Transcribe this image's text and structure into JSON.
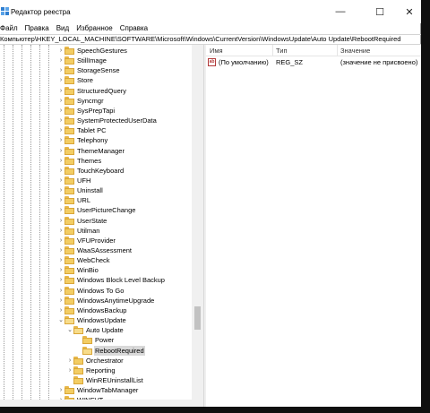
{
  "window": {
    "title": "Редактор реестра",
    "controls": {
      "minimize": "—",
      "maximize": "☐",
      "close": "✕"
    }
  },
  "menu": [
    "Файл",
    "Правка",
    "Вид",
    "Избранное",
    "Справка"
  ],
  "address": "Компьютер\\HKEY_LOCAL_MACHINE\\SOFTWARE\\Microsoft\\Windows\\CurrentVersion\\WindowsUpdate\\Auto Update\\RebootRequired",
  "tree": {
    "items": [
      {
        "label": "SpeechGestures",
        "level": 0,
        "expander": "›",
        "open": false,
        "selected": false
      },
      {
        "label": "StillImage",
        "level": 0,
        "expander": "›",
        "open": false,
        "selected": false
      },
      {
        "label": "StorageSense",
        "level": 0,
        "expander": "›",
        "open": false,
        "selected": false
      },
      {
        "label": "Store",
        "level": 0,
        "expander": "›",
        "open": false,
        "selected": false
      },
      {
        "label": "StructuredQuery",
        "level": 0,
        "expander": "›",
        "open": false,
        "selected": false
      },
      {
        "label": "Syncmgr",
        "level": 0,
        "expander": "›",
        "open": false,
        "selected": false
      },
      {
        "label": "SysPrepTapi",
        "level": 0,
        "expander": "›",
        "open": false,
        "selected": false
      },
      {
        "label": "SystemProtectedUserData",
        "level": 0,
        "expander": "›",
        "open": false,
        "selected": false
      },
      {
        "label": "Tablet PC",
        "level": 0,
        "expander": "›",
        "open": false,
        "selected": false
      },
      {
        "label": "Telephony",
        "level": 0,
        "expander": "›",
        "open": false,
        "selected": false
      },
      {
        "label": "ThemeManager",
        "level": 0,
        "expander": "›",
        "open": false,
        "selected": false
      },
      {
        "label": "Themes",
        "level": 0,
        "expander": "›",
        "open": false,
        "selected": false
      },
      {
        "label": "TouchKeyboard",
        "level": 0,
        "expander": "›",
        "open": false,
        "selected": false
      },
      {
        "label": "UFH",
        "level": 0,
        "expander": "›",
        "open": false,
        "selected": false
      },
      {
        "label": "Uninstall",
        "level": 0,
        "expander": "›",
        "open": false,
        "selected": false
      },
      {
        "label": "URL",
        "level": 0,
        "expander": "›",
        "open": false,
        "selected": false
      },
      {
        "label": "UserPictureChange",
        "level": 0,
        "expander": "›",
        "open": false,
        "selected": false
      },
      {
        "label": "UserState",
        "level": 0,
        "expander": "›",
        "open": false,
        "selected": false
      },
      {
        "label": "Utilman",
        "level": 0,
        "expander": "›",
        "open": false,
        "selected": false
      },
      {
        "label": "VFUProvider",
        "level": 0,
        "expander": "›",
        "open": false,
        "selected": false
      },
      {
        "label": "WaaSAssessment",
        "level": 0,
        "expander": "›",
        "open": false,
        "selected": false
      },
      {
        "label": "WebCheck",
        "level": 0,
        "expander": "›",
        "open": false,
        "selected": false
      },
      {
        "label": "WinBio",
        "level": 0,
        "expander": "›",
        "open": false,
        "selected": false
      },
      {
        "label": "Windows Block Level Backup",
        "level": 0,
        "expander": "›",
        "open": false,
        "selected": false
      },
      {
        "label": "Windows To Go",
        "level": 0,
        "expander": "›",
        "open": false,
        "selected": false
      },
      {
        "label": "WindowsAnytimeUpgrade",
        "level": 0,
        "expander": "›",
        "open": false,
        "selected": false
      },
      {
        "label": "WindowsBackup",
        "level": 0,
        "expander": "›",
        "open": false,
        "selected": false
      },
      {
        "label": "WindowsUpdate",
        "level": 0,
        "expander": "⌄",
        "open": true,
        "selected": false
      },
      {
        "label": "Auto Update",
        "level": 1,
        "expander": "⌄",
        "open": true,
        "selected": false
      },
      {
        "label": "Power",
        "level": 2,
        "expander": "",
        "open": false,
        "selected": false
      },
      {
        "label": "RebootRequired",
        "level": 2,
        "expander": "",
        "open": true,
        "selected": true
      },
      {
        "label": "Orchestrator",
        "level": 1,
        "expander": "›",
        "open": false,
        "selected": false
      },
      {
        "label": "Reporting",
        "level": 1,
        "expander": "›",
        "open": false,
        "selected": false
      },
      {
        "label": "WinREUninstallList",
        "level": 1,
        "expander": "",
        "open": false,
        "selected": false
      },
      {
        "label": "WindowTabManager",
        "level": 0,
        "expander": "›",
        "open": false,
        "selected": false
      },
      {
        "label": "WINEVT",
        "level": 0,
        "expander": "›",
        "open": false,
        "selected": false
      }
    ]
  },
  "values_pane": {
    "columns": {
      "name": "Имя",
      "type": "Тип",
      "data": "Значение"
    },
    "rows": [
      {
        "icon": "string-value-icon",
        "icon_text": "ab",
        "name": "(По умолчанию)",
        "type": "REG_SZ",
        "data": "(значение не присвоено)"
      }
    ]
  },
  "colors": {
    "folder": "#f3cd63",
    "selection": "#d9d9d9",
    "frame": "#0f0f0f"
  }
}
